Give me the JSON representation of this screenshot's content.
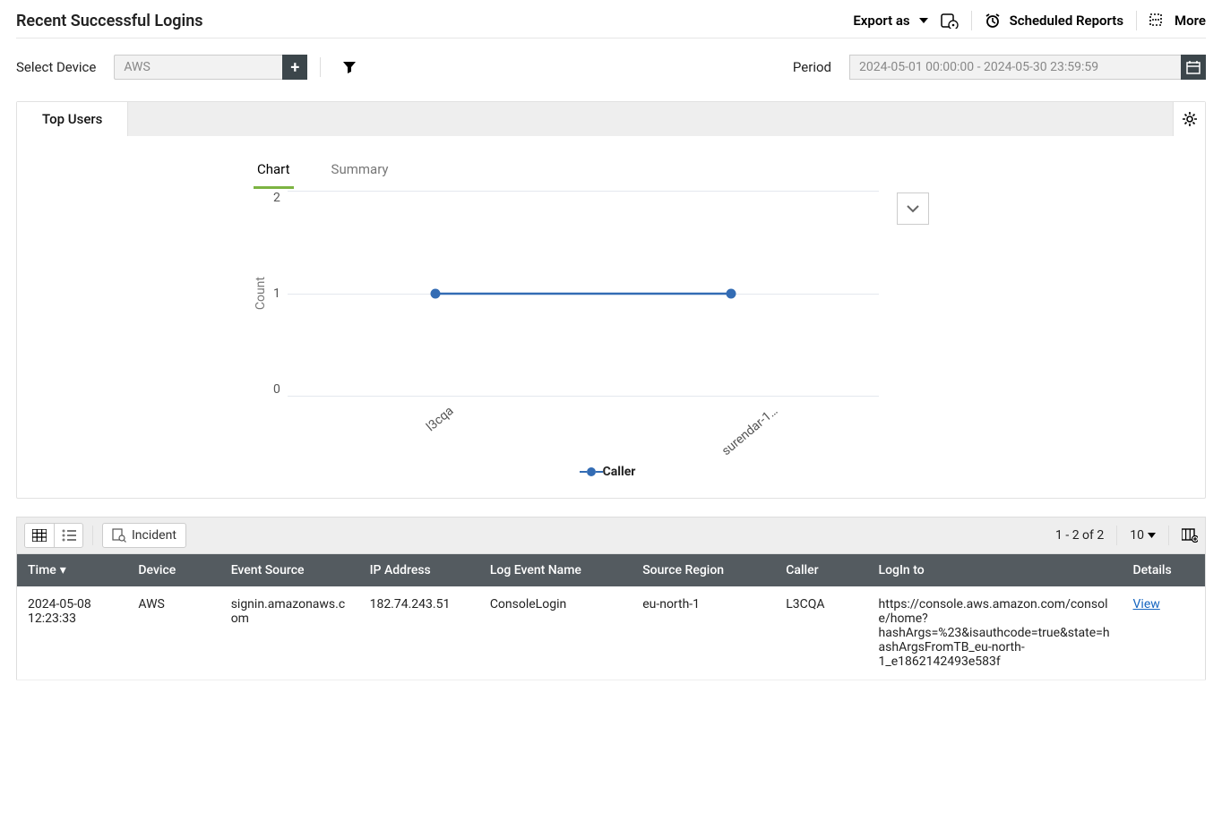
{
  "header": {
    "title": "Recent Successful Logins",
    "export_label": "Export as",
    "scheduled_label": "Scheduled Reports",
    "more_label": "More"
  },
  "filters": {
    "device_label": "Select Device",
    "device_value": "AWS",
    "period_label": "Period",
    "period_value": "2024-05-01 00:00:00 - 2024-05-30 23:59:59"
  },
  "panel": {
    "tab_label": "Top Users",
    "subtabs": {
      "chart": "Chart",
      "summary": "Summary"
    },
    "legend": "Caller"
  },
  "chart_data": {
    "type": "line",
    "ylabel": "Count",
    "ylim": [
      0,
      2
    ],
    "yticks": [
      2,
      1,
      0
    ],
    "categories": [
      "l3cqa",
      "surendar-1…"
    ],
    "series": [
      {
        "name": "Caller",
        "values": [
          1,
          1
        ],
        "color": "#336cb4"
      }
    ]
  },
  "table_toolbar": {
    "incident_label": "Incident",
    "pagination": "1 - 2 of 2",
    "page_size": "10"
  },
  "table": {
    "columns": [
      "Time",
      "Device",
      "Event Source",
      "IP Address",
      "Log Event Name",
      "Source Region",
      "Caller",
      "LogIn to",
      "Details"
    ],
    "rows": [
      {
        "time": "2024-05-08 12:23:33",
        "device": "AWS",
        "event_source": "signin.amazonaws.com",
        "ip": "182.74.243.51",
        "log_event": "ConsoleLogin",
        "region": "eu-north-1",
        "caller": "L3CQA",
        "login_to": "https://console.aws.amazon.com/console/home?hashArgs=%23&isauthcode=true&state=hashArgsFromTB_eu-north-1_e1862142493e583f",
        "details": "View"
      }
    ]
  }
}
